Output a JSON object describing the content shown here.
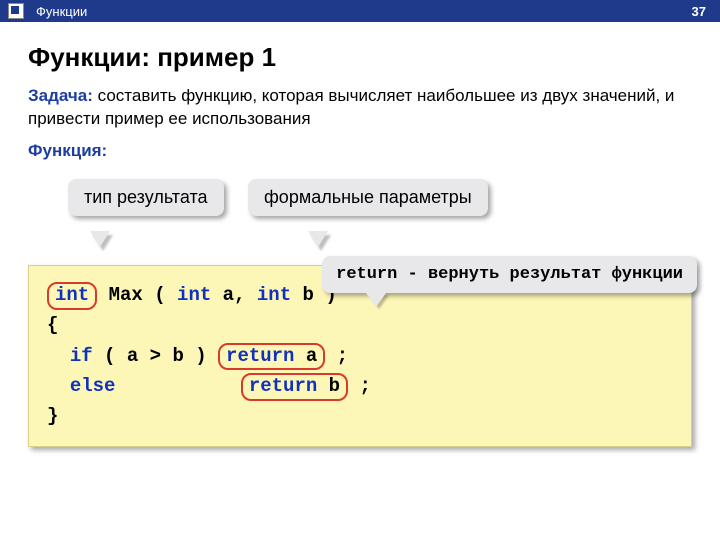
{
  "topbar": {
    "section": "Функции",
    "page": "37"
  },
  "title": "Функции: пример 1",
  "task": {
    "label": "Задача:",
    "text": " составить функцию, которая вычисляет наибольшее из двух значений, и привести пример ее использования"
  },
  "func_label": "Функция:",
  "callouts": {
    "result_type": "тип результата",
    "formal_params": "формальные параметры",
    "return_kw": "return",
    "return_text": " - вернуть результат функции"
  },
  "code": {
    "ret_type": "int",
    "name": " Max ( ",
    "p1_type": "int",
    "p1_name": " a",
    "comma": ", ",
    "p2_type": "int",
    "p2_name": " b",
    "close_sig": " )",
    "brace_open": "{",
    "if_kw": "if",
    "if_cond": " ( a > b ) ",
    "ret1_kw": "return",
    "ret1_val": " a",
    "semi1": " ;",
    "else_kw": "else",
    "else_pad": "           ",
    "ret2_kw": "return",
    "ret2_val": " b",
    "semi2": " ;",
    "brace_close": "}"
  }
}
